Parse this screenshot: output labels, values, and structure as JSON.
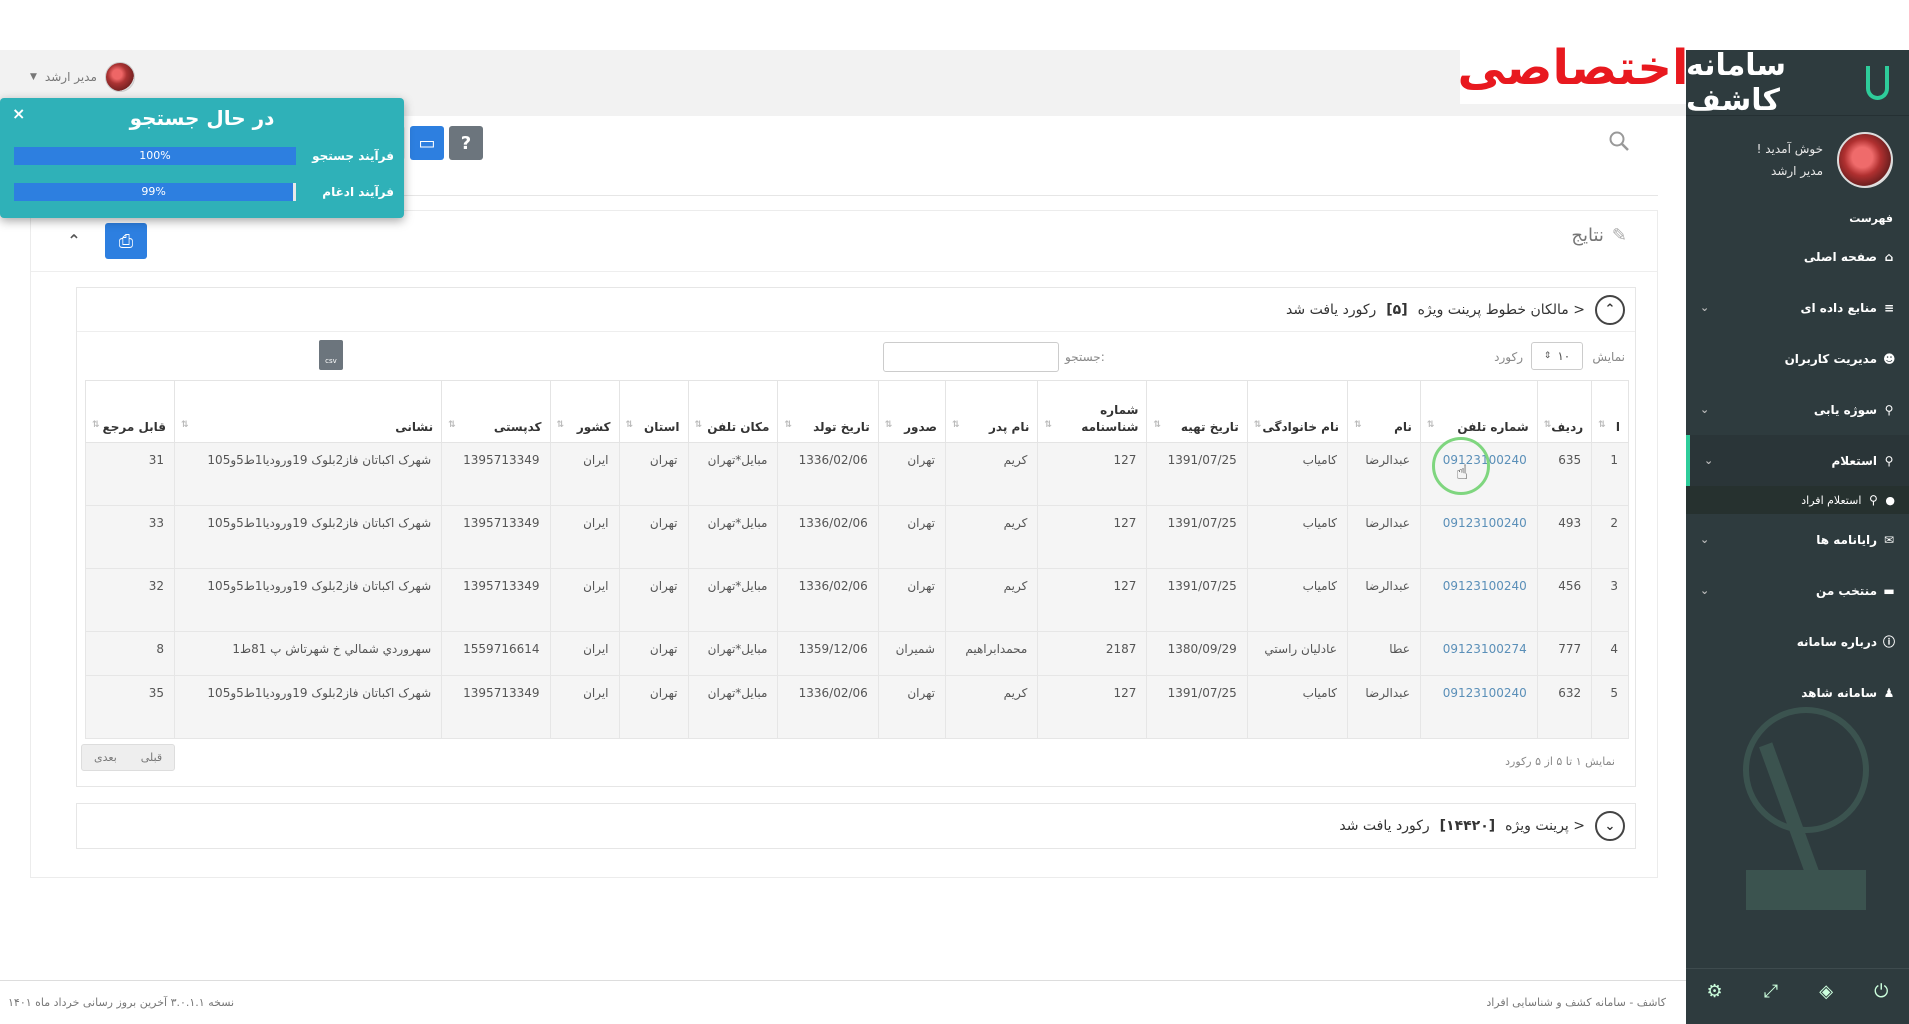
{
  "header": {
    "user_name": "مدیر ارشد",
    "exclusive_label": "اختصاصی"
  },
  "sidebar": {
    "logo_text": "سامانه کاشف",
    "welcome": "خوش آمدید !",
    "role": "مدیر ارشد",
    "menu_title": "فهرست",
    "items": [
      {
        "label": "صفحه اصلی",
        "icon": "home-icon",
        "has_chevron": false
      },
      {
        "label": "منابع داده ای",
        "icon": "database-icon",
        "has_chevron": true
      },
      {
        "label": "مدیریت کاربران",
        "icon": "users-icon",
        "has_chevron": false
      },
      {
        "label": "سوژه یابی",
        "icon": "search-icon",
        "has_chevron": true
      },
      {
        "label": "استعلام",
        "icon": "search-icon",
        "has_chevron": true
      },
      {
        "label": "رایانامه ها",
        "icon": "mail-icon",
        "has_chevron": true
      },
      {
        "label": "منتخب من",
        "icon": "folder-icon",
        "has_chevron": true
      },
      {
        "label": "درباره سامانه",
        "icon": "info-icon",
        "has_chevron": false
      },
      {
        "label": "سامانه شاهد",
        "icon": "user-icon",
        "has_chevron": false
      }
    ],
    "active_submenu": "استعلام افراد"
  },
  "popup": {
    "title": "در حال جستجو",
    "bars": [
      {
        "label": "فرآیند جستجو",
        "value_text": "100%",
        "value": 1.0
      },
      {
        "label": "فرآیند ادغام",
        "value_text": "99%",
        "value": 0.99
      }
    ]
  },
  "results": {
    "title": "نتایج",
    "sub_title_prefix": "مالکان خطوط پرینت ویژه >",
    "sub_title_count": "[۵]",
    "sub_title_suffix": "رکورد یافت شد",
    "show_label": "نمایش",
    "show_value": "۱۰",
    "records_label": "رکورد",
    "search_label": "جستجو:",
    "csv_label": "csv",
    "columns": [
      "ا",
      "ردیف",
      "شماره تلفن",
      "نام",
      "نام خانوادگی",
      "تاریخ تهیه",
      "شماره شناسنامه",
      "نام پدر",
      "صدور",
      "تاریخ تولد",
      "مکان تلفن",
      "استان",
      "کشور",
      "کدپستی",
      "نشانی",
      "قابل مرجع"
    ],
    "rows": [
      [
        "1",
        "635",
        "09123100240",
        "عبدالرضا",
        "کامیاب",
        "1391/07/25",
        "127",
        "کریم",
        "تهران",
        "1336/02/06",
        "مبایل*تهران",
        "تهران",
        "ایران",
        "1395713349",
        "شهرک اکباتان فاز2بلوک 19وروديا1ط5و105",
        "31"
      ],
      [
        "2",
        "493",
        "09123100240",
        "عبدالرضا",
        "کامیاب",
        "1391/07/25",
        "127",
        "کریم",
        "تهران",
        "1336/02/06",
        "مبایل*تهران",
        "تهران",
        "ایران",
        "1395713349",
        "شهرک اکباتان فاز2بلوک 19وروديا1ط5و105",
        "33"
      ],
      [
        "3",
        "456",
        "09123100240",
        "عبدالرضا",
        "کامیاب",
        "1391/07/25",
        "127",
        "کریم",
        "تهران",
        "1336/02/06",
        "مبایل*تهران",
        "تهران",
        "ایران",
        "1395713349",
        "شهرک اکباتان فاز2بلوک 19وروديا1ط5و105",
        "32"
      ],
      [
        "4",
        "777",
        "09123100274",
        "عطا",
        "عادليان راستي",
        "1380/09/29",
        "2187",
        "محمدابراهيم",
        "شميران",
        "1359/12/06",
        "مبایل*تهران",
        "تهران",
        "ایران",
        "1559716614",
        "سهروردي شمالي خ شهرتاش پ 81ط1",
        "8"
      ],
      [
        "5",
        "632",
        "09123100240",
        "عبدالرضا",
        "کامیاب",
        "1391/07/25",
        "127",
        "کریم",
        "تهران",
        "1336/02/06",
        "مبایل*تهران",
        "تهران",
        "ایران",
        "1395713349",
        "شهرک اکباتان فاز2بلوک 19وروديا1ط5و105",
        "35"
      ]
    ],
    "info": "نمایش ۱ تا ۵ از ۵ رکورد",
    "prev": "قبلی",
    "next": "بعدی",
    "second_prefix": "پرینت ویژه >",
    "second_count": "[۱۴۴۲۰]",
    "second_suffix": "رکورد یافت شد"
  },
  "footer": {
    "left": "نسخه ۳.۰.۱.۱ آخرین بروز رسانی خرداد ماه ۱۴۰۱",
    "right": "کاشف - سامانه کشف و شناسایی افراد"
  },
  "colors": {
    "sidebar_bg": "#2e3b3e",
    "accent": "#2ecc9a",
    "primary_button": "#2d7fe0",
    "popup_bg": "#2fb1b8",
    "exclusive_red": "#e8191f"
  }
}
